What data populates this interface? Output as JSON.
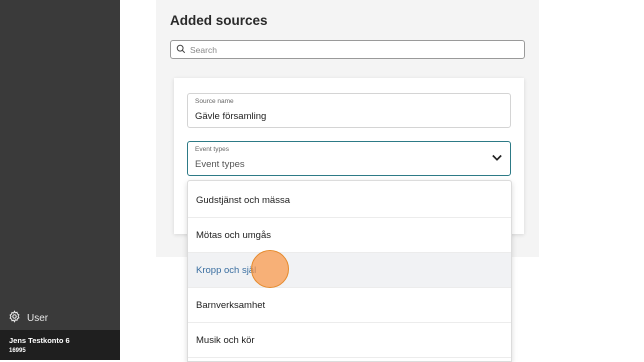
{
  "sidebar": {
    "user_label": "User",
    "account_name": "Jens Testkonto 6",
    "account_id": "16995"
  },
  "panel": {
    "title": "Added sources",
    "search_placeholder": "Search"
  },
  "form": {
    "source_name_label": "Source name",
    "source_name_value": "Gävle församling",
    "event_types_label": "Event types",
    "event_types_value": "Event types"
  },
  "dropdown": {
    "options": [
      "Gudstjänst och mässa",
      "Mötas och umgås",
      "Kropp och själ",
      "Barnverksamhet",
      "Musik och kör"
    ],
    "hovered_index": 2
  },
  "colors": {
    "sidebar_bg": "#3a3a3a",
    "account_bg": "#1f1f1f",
    "focus_border": "#2d7a86",
    "hover_text": "#3a6ea0",
    "click_indicator": "#f5943f"
  }
}
